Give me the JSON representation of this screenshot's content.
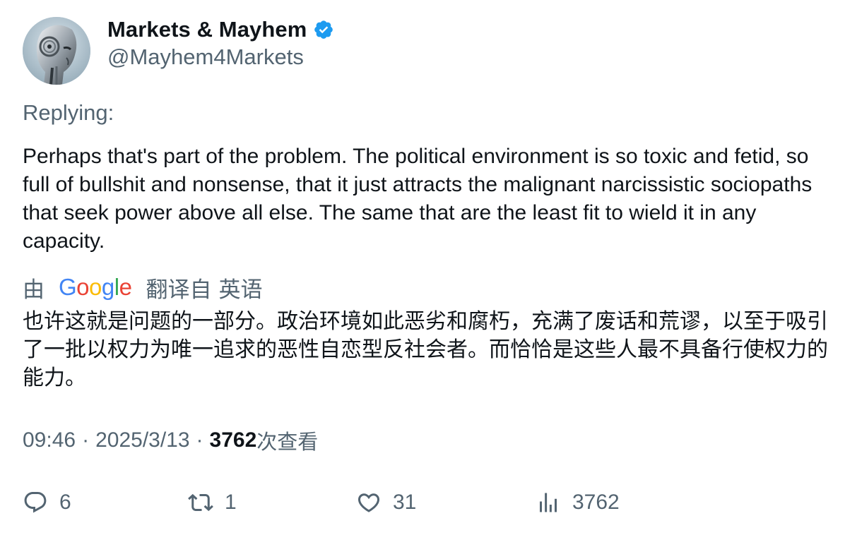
{
  "author": {
    "display_name": "Markets & Mayhem",
    "handle": "@Mayhem4Markets",
    "verified": true,
    "avatar_icon": "robot-head-avatar"
  },
  "replying_label": "Replying:",
  "tweet": {
    "text": "Perhaps that's part of the problem. The political environment is so toxic and fetid, so full of bullshit and nonsense, that it just attracts the malignant narcissistic sociopaths that seek power above all else. The same that are the least fit to wield it in any capacity."
  },
  "translation": {
    "prefix": "由",
    "provider": "Google",
    "suffix": "翻译自",
    "source_language": "英语",
    "text": "也许这就是问题的一部分。政治环境如此恶劣和腐朽，充满了废话和荒谬，以至于吸引了一批以权力为唯一追求的恶性自恋型反社会者。而恰恰是这些人最不具备行使权力的能力。"
  },
  "meta": {
    "time": "09:46",
    "separator": "·",
    "date": "2025/3/13",
    "views_count": "3762",
    "views_label": "次查看"
  },
  "actions": {
    "replies": "6",
    "retweets": "1",
    "likes": "31",
    "views": "3762"
  },
  "colors": {
    "text_primary": "#0f1419",
    "text_secondary": "#536471",
    "verified_blue": "#1d9bf0",
    "google_blue": "#4285f4",
    "google_red": "#ea4335",
    "google_yellow": "#fbbc05",
    "google_green": "#34a853"
  }
}
